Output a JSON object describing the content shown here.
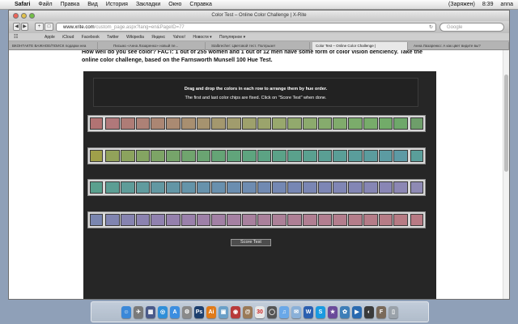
{
  "menubar": {
    "apple_glyph": "",
    "app": "Safari",
    "items": [
      "Файл",
      "Правка",
      "Вид",
      "История",
      "Закладки",
      "Окно",
      "Справка"
    ],
    "status": {
      "battery": "(Заряжен)",
      "time": "8:39",
      "user": "anna"
    }
  },
  "window": {
    "title": "Color Test – Online Color Challenge | X-Rite",
    "address": {
      "host": "www.xrite.com",
      "path": "/custom_page.aspx?lang=en&PageID=77",
      "reload_glyph": "↻"
    },
    "search_placeholder": "Google",
    "nav": {
      "back": "◀",
      "forward": "▶",
      "add_bookmark": "+",
      "share": "□"
    }
  },
  "bookmarks": {
    "icon": "☷",
    "items": [
      "Apple",
      "iCloud",
      "Facebook",
      "Twitter",
      "Wikipedia",
      "Яндекс",
      "Yahoo!",
      "Новости ▾",
      "Популярное ▾"
    ]
  },
  "tabs": [
    {
      "label": "ВКОНТАКТЕ   ВАЖНОЕ/ПОИСК   подарки неа",
      "active": false
    },
    {
      "label": "Письмо «Анна Лазаренко» новый пе...",
      "active": false
    },
    {
      "label": "Stalbrecher: Цветовой тест. Полгрызе!",
      "active": false
    },
    {
      "label": "Color Test – Online Color Challenge |",
      "active": true
    },
    {
      "label": "Анна Лазаренко: А как цвет видите вы?",
      "active": false
    }
  ],
  "content": {
    "intro": "How well do you see color? FACT: 1 out of 255 women and 1 out of 12 men have some form of color vision deficiency. Take the online color challenge, based on the Farnsworth Munsell 100 Hue Test.",
    "instructions_1": "Drag and drop the colors in each row to arrange them by hue order.",
    "instructions_2": "The first and last color chips are fixed. Click on \"Score Test\" when done.",
    "score_button": "Score Test"
  },
  "hue_rows": [
    {
      "first": "#b27373",
      "last": "#6e9e6a",
      "chips": [
        "#b0787a",
        "#ae7c76",
        "#ad8176",
        "#ab8673",
        "#aa8a72",
        "#a88f70",
        "#a6936f",
        "#a4986e",
        "#a19c6d",
        "#9ea16c",
        "#9ba46c",
        "#98a86d",
        "#92a96d",
        "#8caa6d",
        "#86ab6d",
        "#80ab6c",
        "#7bac6b",
        "#77ac6a",
        "#72ab69",
        "#6ea86a"
      ]
    },
    {
      "first": "#a0a04a",
      "last": "#5a9e9a",
      "chips": [
        "#92a25a",
        "#8ba35e",
        "#84a462",
        "#7da466",
        "#76a46a",
        "#70a46e",
        "#6aa472",
        "#65a476",
        "#61a47b",
        "#5ea47f",
        "#5ca384",
        "#5ba288",
        "#5aa18c",
        "#5aa090",
        "#5a9f94",
        "#5a9e97",
        "#5a9d9b",
        "#5b9c9e",
        "#5c9ba2",
        "#5d9aa5"
      ]
    },
    {
      "first": "#5aa08e",
      "last": "#8e8ab4",
      "chips": [
        "#5c9e94",
        "#5e9c99",
        "#609b9e",
        "#6298a2",
        "#6396a6",
        "#6594a9",
        "#6792ac",
        "#6990ae",
        "#6b8eb0",
        "#6e8cb1",
        "#718ab2",
        "#7488b3",
        "#7787b4",
        "#7a86b4",
        "#7d86b5",
        "#8086b5",
        "#8386b5",
        "#8686b5",
        "#8986b5",
        "#8c87b4"
      ]
    },
    {
      "first": "#7a86b0",
      "last": "#b87a84",
      "chips": [
        "#8084b0",
        "#8683b0",
        "#8b82b0",
        "#9081af",
        "#9580ad",
        "#9a80ab",
        "#9e80a8",
        "#a280a5",
        "#a580a2",
        "#a8809e",
        "#aa809b",
        "#ac8098",
        "#ae7f95",
        "#b07e92",
        "#b27e90",
        "#b37d8d",
        "#b47d8a",
        "#b57c88",
        "#b67c86",
        "#b77b84"
      ]
    }
  ],
  "dock": [
    {
      "name": "finder",
      "color": "#3b88d8",
      "glyph": "☺"
    },
    {
      "name": "launchpad",
      "color": "#7a7a7a",
      "glyph": "✈"
    },
    {
      "name": "mission-control",
      "color": "#4a5a8a",
      "glyph": "▦"
    },
    {
      "name": "safari",
      "color": "#2f8fd8",
      "glyph": "◎"
    },
    {
      "name": "app-store",
      "color": "#3c8ee0",
      "glyph": "A"
    },
    {
      "name": "system-preferences",
      "color": "#8a8a8a",
      "glyph": "⚙"
    },
    {
      "name": "photoshop",
      "color": "#1c3f6e",
      "glyph": "Ps"
    },
    {
      "name": "illustrator",
      "color": "#e07b1a",
      "glyph": "Ai"
    },
    {
      "name": "preview",
      "color": "#6aa0c8",
      "glyph": "▣"
    },
    {
      "name": "photo-booth",
      "color": "#b83a3a",
      "glyph": "◉"
    },
    {
      "name": "address-book",
      "color": "#9a7a58",
      "glyph": "@"
    },
    {
      "name": "ical",
      "color": "#e8e8e8",
      "glyph": "30"
    },
    {
      "name": "dvd-player",
      "color": "#555555",
      "glyph": "◯"
    },
    {
      "name": "itunes",
      "color": "#6aa8e8",
      "glyph": "♫"
    },
    {
      "name": "mail",
      "color": "#8ab0d8",
      "glyph": "✉"
    },
    {
      "name": "word",
      "color": "#2b5fb0",
      "glyph": "W"
    },
    {
      "name": "skype",
      "color": "#1a9ae0",
      "glyph": "S"
    },
    {
      "name": "imovie",
      "color": "#6a4a9a",
      "glyph": "★"
    },
    {
      "name": "iphoto",
      "color": "#3e7eb8",
      "glyph": "✿"
    },
    {
      "name": "mp-player",
      "color": "#2a6ab0",
      "glyph": "▶"
    },
    {
      "name": "dashboard",
      "color": "#3a3a3a",
      "glyph": "◐"
    },
    {
      "name": "font-book",
      "color": "#7a6a5a",
      "glyph": "F"
    },
    {
      "name": "trash",
      "color": "#9aa2aa",
      "glyph": "▯"
    }
  ]
}
